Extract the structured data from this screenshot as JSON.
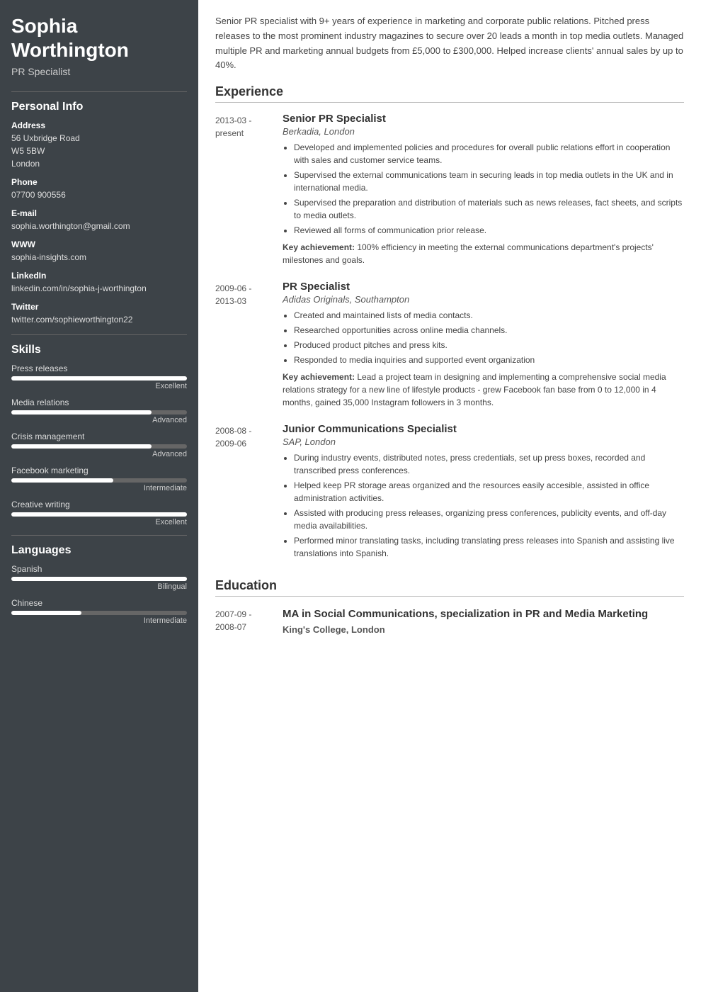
{
  "sidebar": {
    "name": "Sophia\nWorthington",
    "subtitle": "PR Specialist",
    "personal_info": {
      "section_title": "Personal Info",
      "address_label": "Address",
      "address_lines": [
        "56 Uxbridge Road",
        "W5 5BW",
        "London"
      ],
      "phone_label": "Phone",
      "phone": "07700 900556",
      "email_label": "E-mail",
      "email": "sophia.worthington@gmail.com",
      "www_label": "WWW",
      "www": "sophia-insights.com",
      "linkedin_label": "LinkedIn",
      "linkedin": "linkedin.com/in/sophia-j-worthington",
      "twitter_label": "Twitter",
      "twitter": "twitter.com/sophieworthington22"
    },
    "skills": {
      "section_title": "Skills",
      "items": [
        {
          "name": "Press releases",
          "level": "Excellent",
          "pct": 100
        },
        {
          "name": "Media relations",
          "level": "Advanced",
          "pct": 80
        },
        {
          "name": "Crisis management",
          "level": "Advanced",
          "pct": 80
        },
        {
          "name": "Facebook marketing",
          "level": "Intermediate",
          "pct": 58
        },
        {
          "name": "Creative writing",
          "level": "Excellent",
          "pct": 100
        }
      ]
    },
    "languages": {
      "section_title": "Languages",
      "items": [
        {
          "name": "Spanish",
          "level": "Bilingual",
          "pct": 100
        },
        {
          "name": "Chinese",
          "level": "Intermediate",
          "pct": 40
        }
      ]
    }
  },
  "main": {
    "summary": "Senior PR specialist with 9+ years of experience in marketing and corporate public relations. Pitched press releases to the most prominent industry magazines to secure over 20 leads a month in top media outlets. Managed multiple PR and marketing annual budgets from £5,000 to £300,000. Helped increase clients' annual sales by up to 40%.",
    "experience_title": "Experience",
    "experience": [
      {
        "date": "2013-03 -\npresent",
        "title": "Senior PR Specialist",
        "company": "Berkadia, London",
        "bullets": [
          "Developed and implemented policies and procedures for overall public relations effort in cooperation with sales and customer service teams.",
          "Supervised the external communications team in securing leads in top media outlets in the UK and in international media.",
          "Supervised the preparation and distribution of materials such as news releases, fact sheets, and scripts to media outlets.",
          "Reviewed all forms of communication prior release."
        ],
        "achievement": "100% efficiency in meeting the external communications department's projects' milestones and goals."
      },
      {
        "date": "2009-06 -\n2013-03",
        "title": "PR Specialist",
        "company": "Adidas Originals, Southampton",
        "bullets": [
          "Created and maintained lists of media contacts.",
          "Researched opportunities across online media channels.",
          "Produced product pitches and press kits.",
          "Responded to media inquiries and supported event organization"
        ],
        "achievement": "Lead a project team in designing and implementing a comprehensive social media relations strategy for a new line of lifestyle products - grew Facebook fan base from 0 to 12,000 in 4 months, gained 35,000 Instagram followers in 3 months."
      },
      {
        "date": "2008-08 -\n2009-06",
        "title": "Junior Communications Specialist",
        "company": "SAP, London",
        "bullets": [
          "During industry events, distributed notes, press credentials, set up press boxes, recorded and transcribed press conferences.",
          "Helped keep PR storage areas organized and the resources easily accesible, assisted in office administration activities.",
          "Assisted with producing press releases, organizing press conferences, publicity events, and off-day media availabilities.",
          "Performed minor translating tasks, including translating press releases into Spanish and assisting live translations into Spanish."
        ],
        "achievement": ""
      }
    ],
    "education_title": "Education",
    "education": [
      {
        "date": "2007-09 -\n2008-07",
        "title": "MA in Social Communications, specialization in PR and Media Marketing",
        "school": "King's College, London"
      }
    ]
  }
}
